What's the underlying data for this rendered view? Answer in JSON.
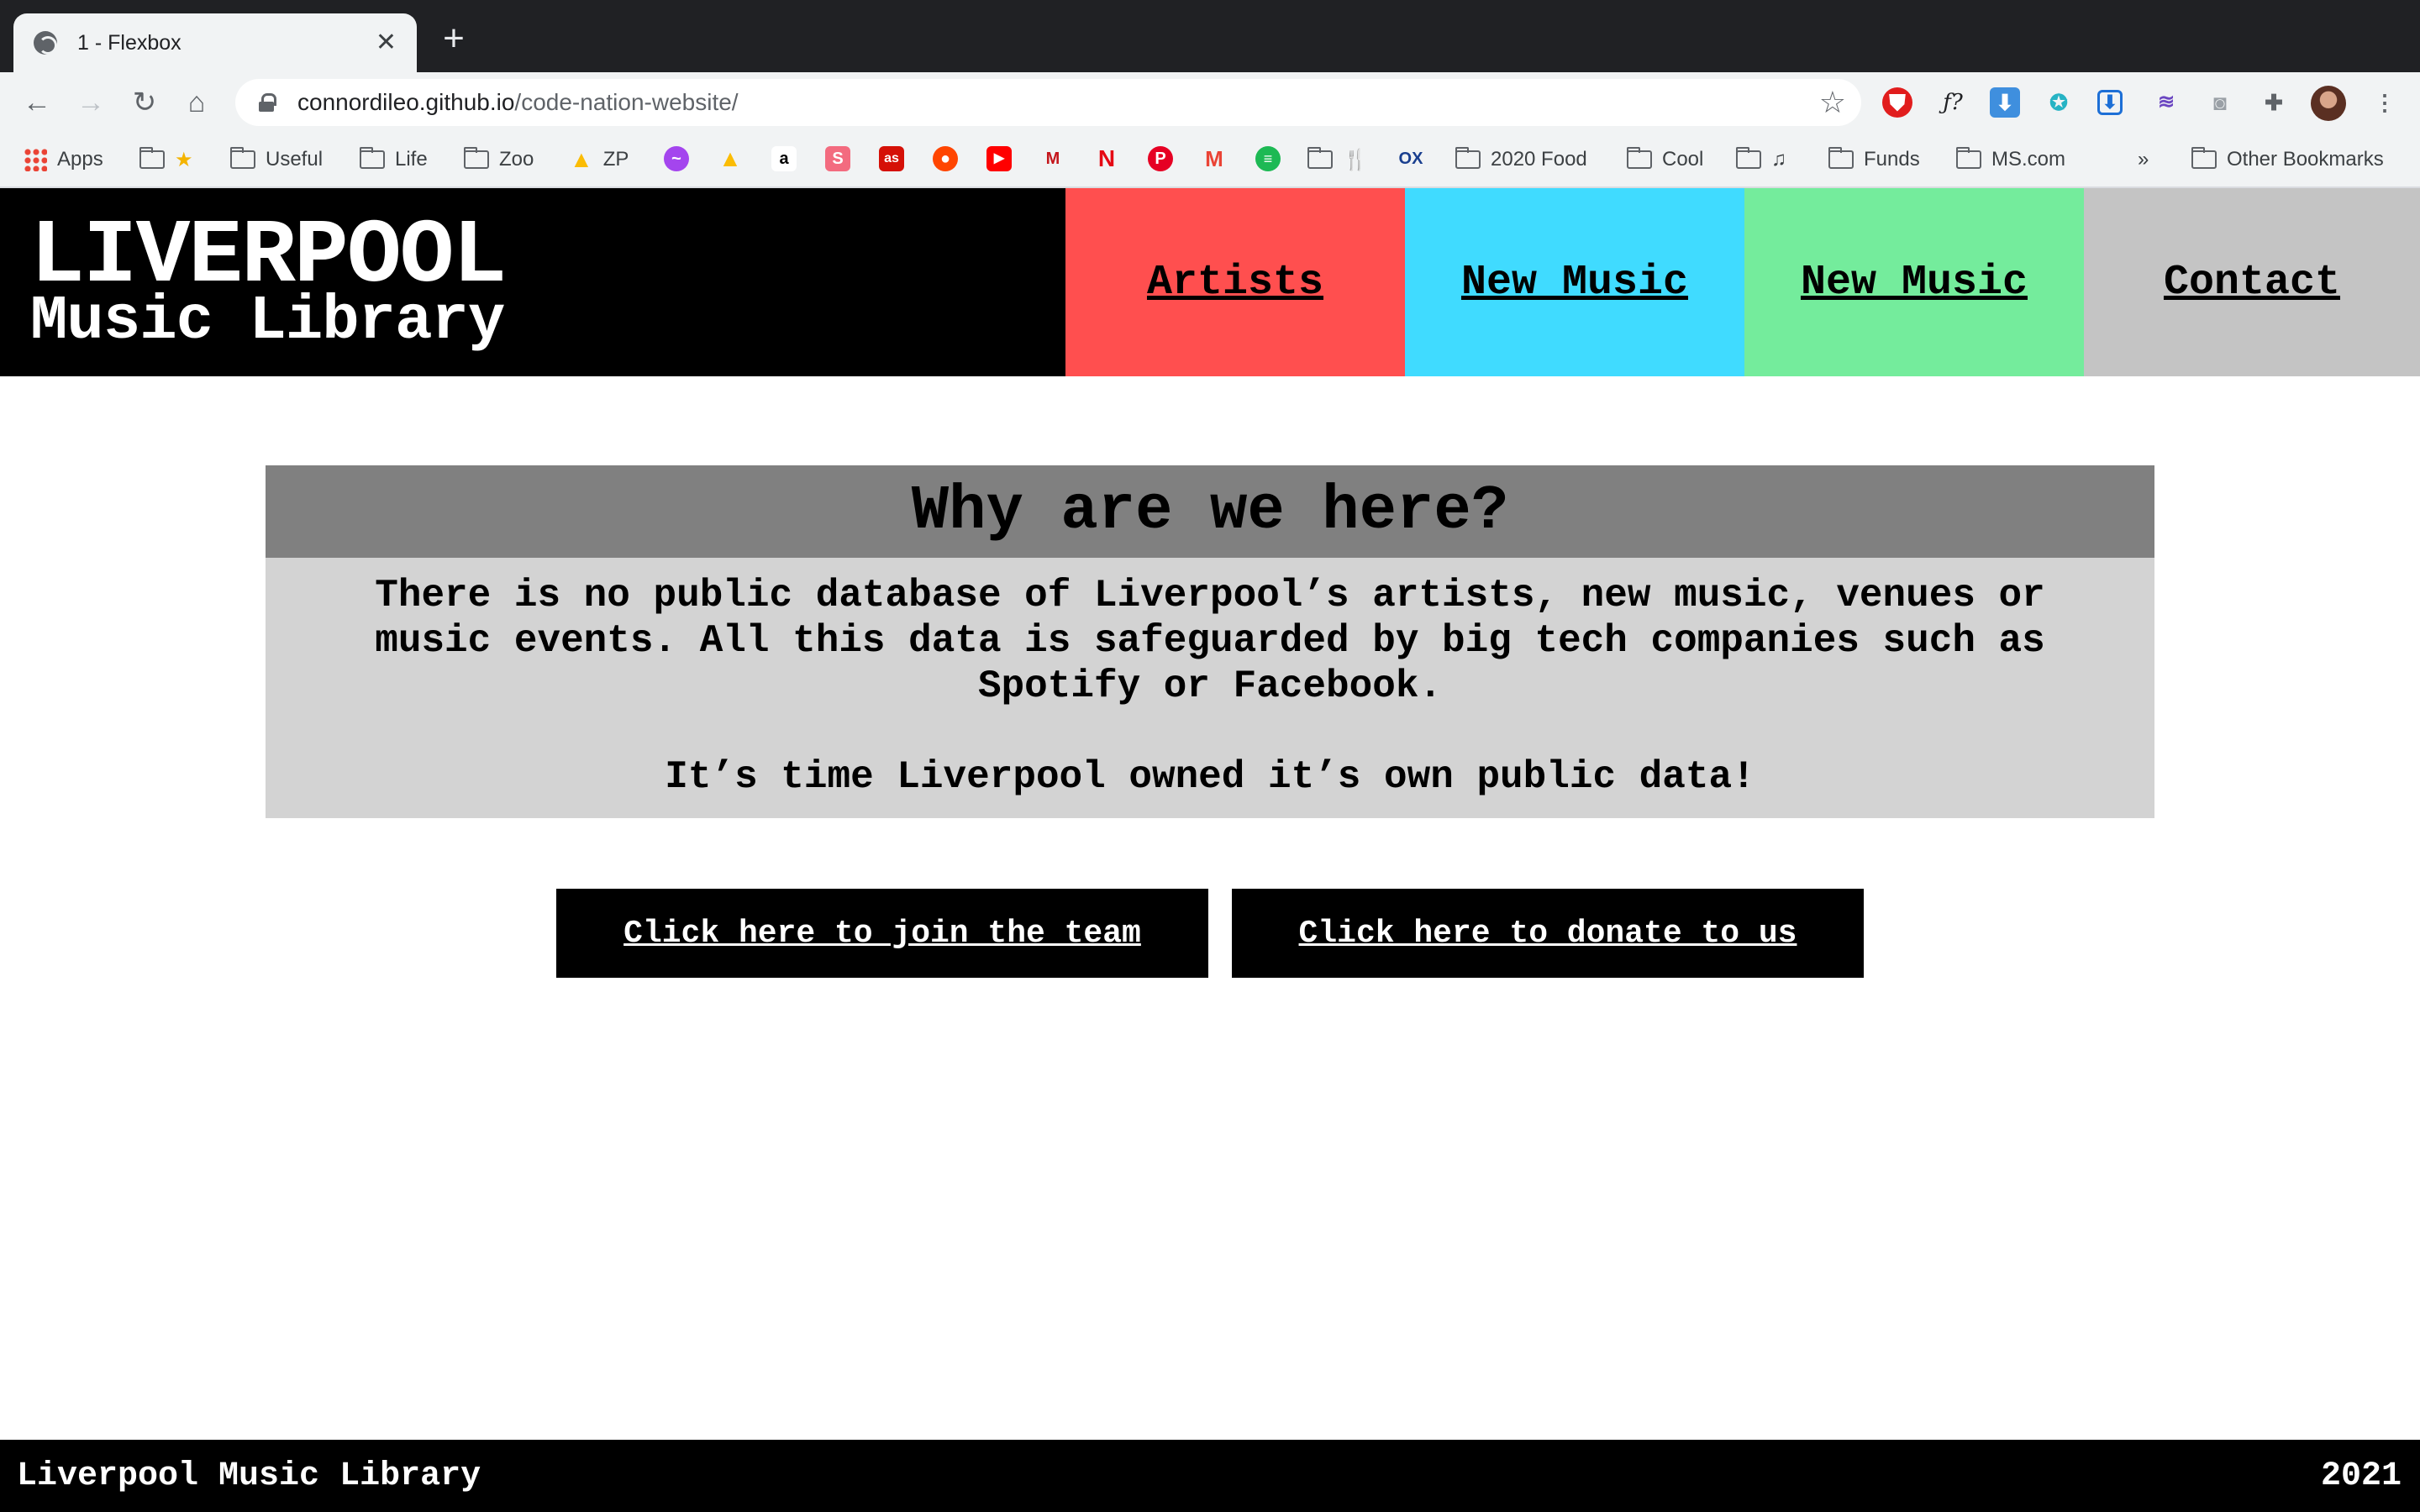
{
  "browser": {
    "tab_title": "1 - Flexbox",
    "url_host": "connordileo.github.io",
    "url_path": "/code-nation-website/",
    "bookmarks": {
      "apps": "Apps",
      "useful": "Useful",
      "life": "Life",
      "zoo": "Zoo",
      "zp": "ZP",
      "food": "2020 Food",
      "cool": "Cool",
      "funds": "Funds",
      "ms": "MS.com",
      "overflow": "»",
      "other": "Other Bookmarks"
    }
  },
  "site": {
    "logo_line1": "LIVERPOOL",
    "logo_line2": "Music Library",
    "nav": [
      {
        "label": "Artists",
        "color": "#ff4f4f"
      },
      {
        "label": "New Music",
        "color": "#40dbff"
      },
      {
        "label": "New Music",
        "color": "#74ec9c"
      },
      {
        "label": "Contact",
        "color": "#c4c4c4"
      }
    ],
    "why": {
      "heading": "Why are we here?",
      "paragraph1": "There is no public database of Liverpool’s artists, new music, venues or music events. All this data is safeguarded by big tech companies such as Spotify or Facebook.",
      "paragraph2": "It’s time Liverpool owned it’s own public data!"
    },
    "buttons": {
      "join": "Click here to join the team",
      "donate": "Click here to donate to us"
    },
    "footer": {
      "name": "Liverpool Music Library",
      "year": "2021"
    }
  }
}
